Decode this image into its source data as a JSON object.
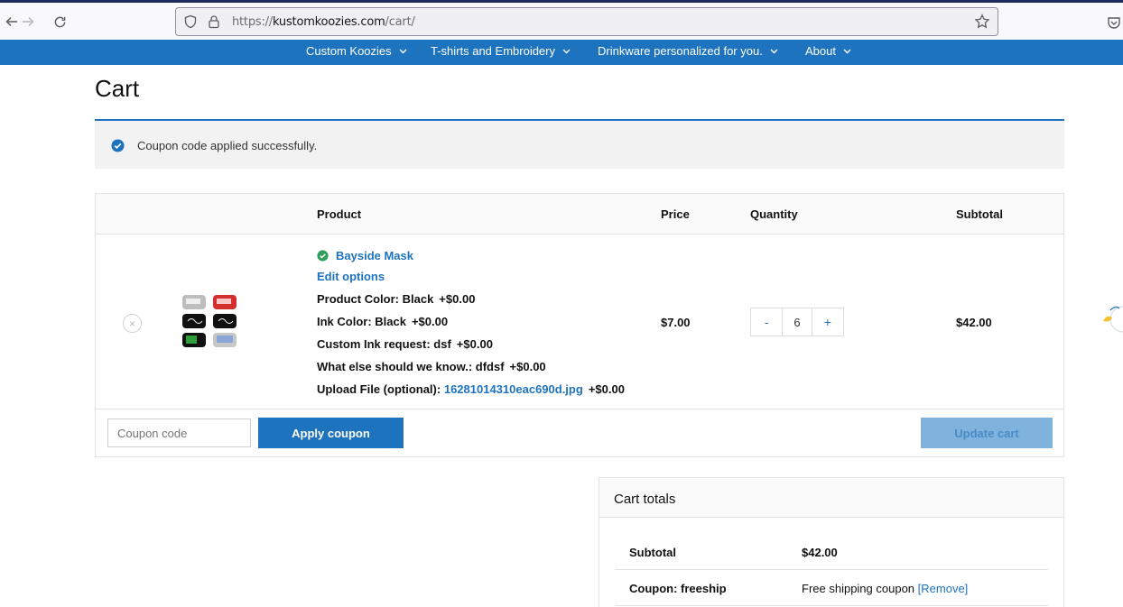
{
  "browser": {
    "url_prefix": "https://",
    "url_host": "kustomkoozies.com",
    "url_path": "/cart/"
  },
  "nav": {
    "items": [
      {
        "label": "Custom Koozies"
      },
      {
        "label": "T-shirts and Embroidery"
      },
      {
        "label": "Drinkware personalized for you."
      },
      {
        "label": "About"
      }
    ]
  },
  "page": {
    "title": "Cart",
    "notice": "Coupon code applied successfully."
  },
  "cart": {
    "headers": {
      "product": "Product",
      "price": "Price",
      "quantity": "Quantity",
      "subtotal": "Subtotal"
    },
    "item": {
      "remove": "×",
      "name": "Bayside Mask",
      "edit_options": "Edit options",
      "meta": [
        {
          "label": "Product Color: Black",
          "extra": "+$0.00"
        },
        {
          "label": "Ink Color: Black",
          "extra": "+$0.00"
        },
        {
          "label": "Custom Ink request: dsf",
          "extra": "+$0.00"
        },
        {
          "label": "What else should we know.: dfdsf",
          "extra": "+$0.00"
        }
      ],
      "upload_label": "Upload File (optional):",
      "upload_file": "16281014310eac690d.jpg",
      "upload_extra": "+$0.00",
      "price": "$7.00",
      "qty_minus": "-",
      "qty_value": "6",
      "qty_plus": "+",
      "subtotal": "$42.00"
    },
    "coupon_placeholder": "Coupon code",
    "apply_coupon": "Apply coupon",
    "update_cart": "Update cart"
  },
  "totals": {
    "title": "Cart totals",
    "subtotal_label": "Subtotal",
    "subtotal_value": "$42.00",
    "coupon_label": "Coupon: freeship",
    "coupon_value": "Free shipping coupon",
    "coupon_remove": "[Remove]"
  },
  "colors": {
    "brand_blue": "#1e73be",
    "update_disabled": "#7fb3de",
    "notice_bg": "#f2f2f2"
  }
}
